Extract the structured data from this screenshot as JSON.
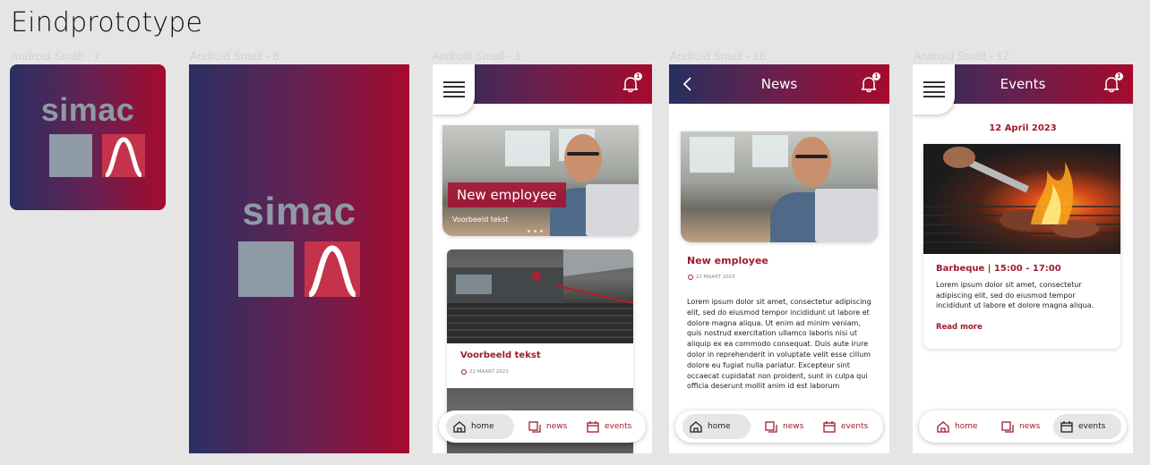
{
  "page_title": "Eindprototype",
  "frames": {
    "f1": {
      "label": "Android Small - 7",
      "logo": "simac"
    },
    "f2": {
      "label": "Android Small - 8",
      "logo": "simac"
    },
    "f3": {
      "label": "Android Small - 1",
      "notification_count": "1",
      "featured": {
        "title": "New employee",
        "caption": "Voorbeeld tekst"
      },
      "card": {
        "title": "Voorbeeld tekst",
        "date": "22 MAART 2023"
      }
    },
    "f4": {
      "label": "Android Small - 16",
      "header_title": "News",
      "notification_count": "1",
      "article": {
        "title": "New employee",
        "date": "22 MAART 2023",
        "body": "Lorem ipsum dolor sit amet, consectetur adipiscing elit, sed do eiusmod tempor incididunt ut labore et dolore magna aliqua. Ut enim ad minim veniam, quis nostrud exercitation ullamco laboris nisi ut aliquip ex ea commodo consequat. Duis aute irure dolor in reprehenderit in voluptate velit esse cillum dolore eu fugiat nulla pariatur. Excepteur sint occaecat cupidatat non proident, sunt in culpa qui officia deserunt mollit anim id est laborum"
      }
    },
    "f5": {
      "label": "Android Small - 17",
      "header_title": "Events",
      "notification_count": "1",
      "event_date": "12 April 2023",
      "event": {
        "title": "Barbeque | 15:00 - 17:00",
        "body": "Lorem ipsum dolor sit amet, consectetur adipiscing elit, sed do eiusmod tempor incididunt ut labore et dolore magna aliqua.",
        "read_more": "Read more"
      }
    }
  },
  "nav": {
    "home": "home",
    "news": "news",
    "events": "events"
  },
  "colors": {
    "brand_red": "#a60a2d",
    "brand_navy": "#2a3063",
    "logo_grey": "#8e9aa5"
  },
  "icons": [
    "hamburger-icon",
    "bell-icon",
    "back-arrow-icon",
    "home-icon",
    "news-icon",
    "calendar-icon",
    "clock-icon"
  ]
}
